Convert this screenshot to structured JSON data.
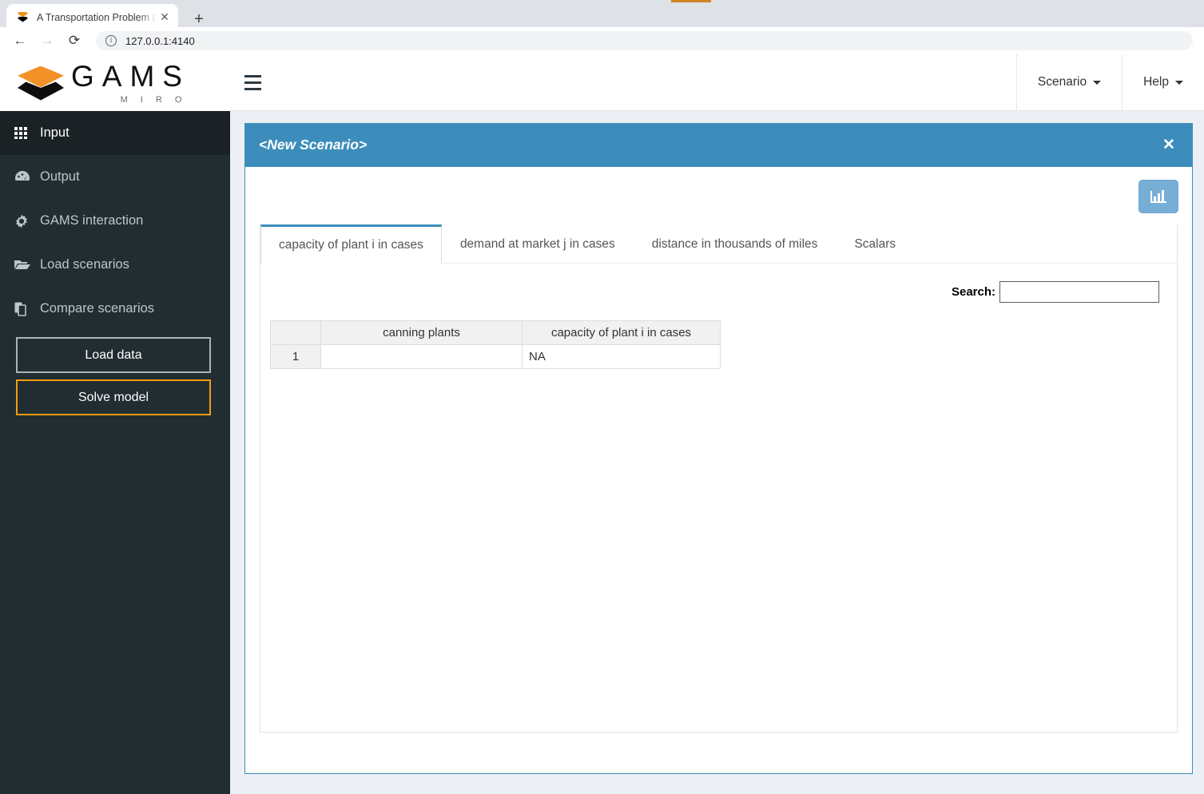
{
  "browser": {
    "tab_title": "A Transportation Problem (TRNSP",
    "tab_close_label": "✕",
    "new_tab_label": "+",
    "back_label": "←",
    "forward_label": "→",
    "reload_label": "⟳",
    "info_label": "i",
    "url": "127.0.0.1:4140"
  },
  "logo": {
    "brand": "GAMS",
    "sub": "M I R O"
  },
  "header": {
    "menus": [
      {
        "label": "Scenario"
      },
      {
        "label": "Help"
      }
    ]
  },
  "sidebar": {
    "items": [
      {
        "label": "Input",
        "icon": "grid-icon",
        "active": true
      },
      {
        "label": "Output",
        "icon": "gauge-icon",
        "active": false
      },
      {
        "label": "GAMS interaction",
        "icon": "gear-icon",
        "active": false
      },
      {
        "label": "Load scenarios",
        "icon": "folder-icon",
        "active": false
      },
      {
        "label": "Compare scenarios",
        "icon": "copy-icon",
        "active": false
      }
    ],
    "buttons": [
      {
        "label": "Load data",
        "accent": false
      },
      {
        "label": "Solve model",
        "accent": true
      }
    ]
  },
  "panel": {
    "title": "<New Scenario>",
    "close_label": "✕",
    "chart_toggle_icon": "bar-chart-icon",
    "tabs": [
      {
        "label": "capacity of plant i in cases",
        "active": true
      },
      {
        "label": "demand at market j in cases",
        "active": false
      },
      {
        "label": "distance in thousands of miles",
        "active": false
      },
      {
        "label": "Scalars",
        "active": false
      }
    ],
    "search": {
      "label": "Search:",
      "value": "",
      "placeholder": ""
    },
    "table": {
      "headers": [
        "",
        "canning plants",
        "capacity of plant i in cases"
      ],
      "rows": [
        {
          "index": "1",
          "name": "",
          "value": "NA"
        }
      ]
    }
  },
  "colors": {
    "accent_blue": "#3c8dbc",
    "accent_orange": "#f39c12",
    "sidebar_bg": "#222d32",
    "sidebar_active": "#1a2226",
    "app_bg": "#ecf0f5"
  }
}
